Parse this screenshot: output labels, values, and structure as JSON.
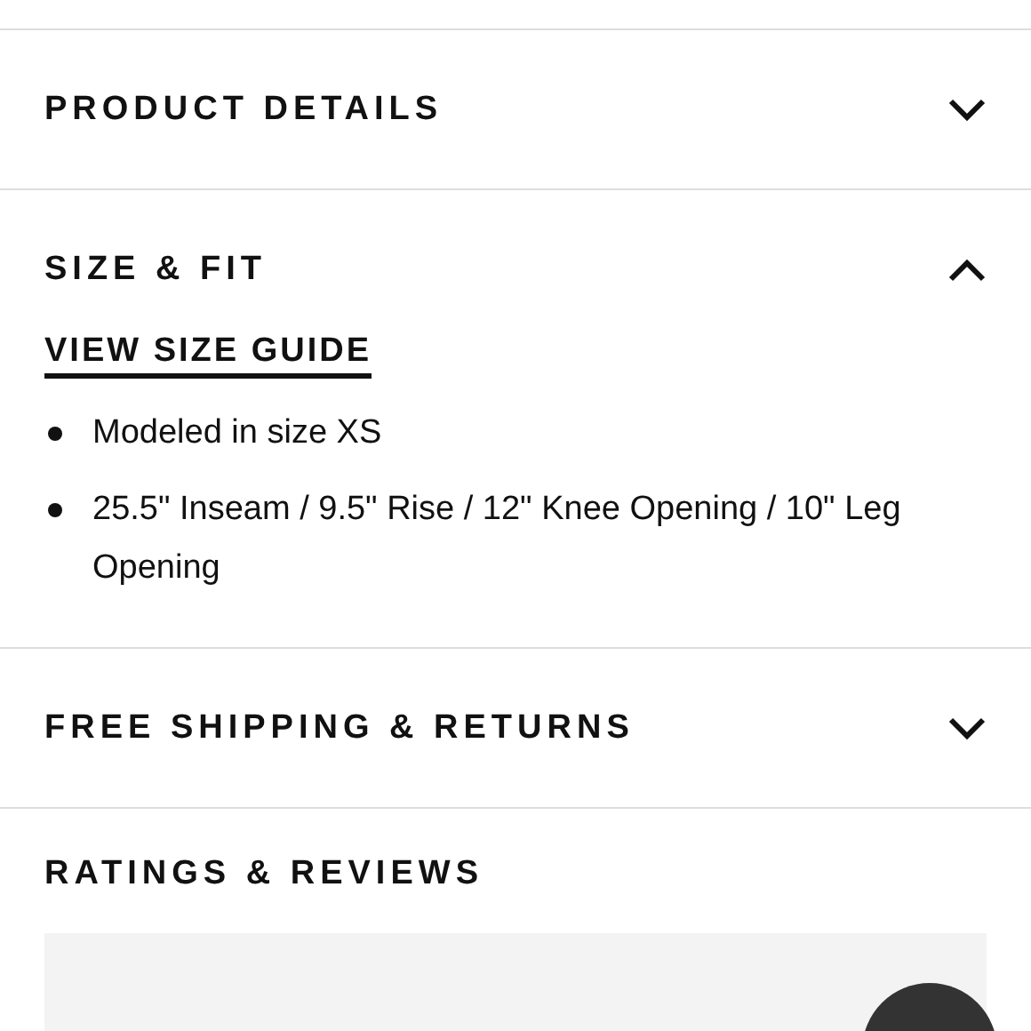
{
  "sections": [
    {
      "kind": "accordion",
      "title": "PRODUCT DETAILS",
      "expanded": false
    },
    {
      "kind": "accordion",
      "title": "SIZE & FIT",
      "expanded": true,
      "link": "VIEW SIZE GUIDE",
      "bullets": [
        "Modeled in size XS",
        "25.5\" Inseam / 9.5\" Rise / 12\" Knee Opening / 10\" Leg Opening"
      ]
    },
    {
      "kind": "accordion",
      "title": "FREE SHIPPING & RETURNS",
      "expanded": false
    },
    {
      "kind": "heading",
      "title": "RATINGS & REVIEWS"
    }
  ]
}
